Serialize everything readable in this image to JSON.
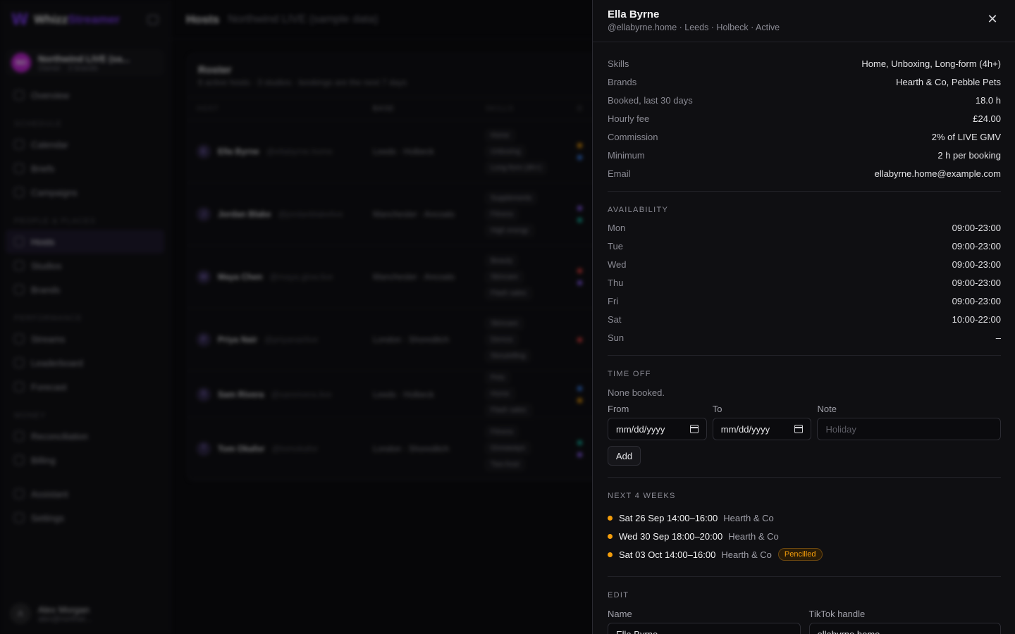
{
  "app": {
    "logo_name": "Whizz",
    "logo_accent": "Streamer",
    "page_title": "Hosts",
    "page_subtitle": "Northwind LIVE (sample data)"
  },
  "org": {
    "initials": "NO",
    "name": "Northwind LIVE (sa...",
    "sub": "Owner · 3 brands"
  },
  "sidebar": {
    "overview": "Overview",
    "sections": [
      "SCHEDULE",
      "PEOPLE & PLACES",
      "PERFORMANCE",
      "MONEY"
    ],
    "schedule": [
      "Calendar",
      "Briefs",
      "Campaigns"
    ],
    "people": [
      "Hosts",
      "Studios",
      "Brands"
    ],
    "performance": [
      "Streams",
      "Leaderboard",
      "Forecast"
    ],
    "money": [
      "Reconciliation",
      "Billing"
    ],
    "bottom": [
      "Assistant",
      "Settings"
    ]
  },
  "user": {
    "initial": "A",
    "name": "Alex Morgan",
    "email": "alex@northwi..."
  },
  "roster": {
    "title": "Roster",
    "subtitle": "6 active hosts · 3 studios · bookings are the next 7 days",
    "headers": [
      "HOST",
      "BASE",
      "SKILLS",
      "B"
    ],
    "rows": [
      {
        "initial": "E",
        "name": "Ella Byrne",
        "handle": "@ellabyrne.home",
        "base": "Leeds · Holbeck",
        "skills": [
          "Home",
          "Unboxing",
          "Long-form (4h+)"
        ]
      },
      {
        "initial": "J",
        "name": "Jordan Blake",
        "handle": "@jordanblakelive",
        "base": "Manchester · Ancoats",
        "skills": [
          "Supplements",
          "Fitness",
          "High energy"
        ]
      },
      {
        "initial": "M",
        "name": "Maya Chen",
        "handle": "@maya.glow.live",
        "base": "Manchester · Ancoats",
        "skills": [
          "Beauty",
          "Skincare",
          "Flash sales"
        ]
      },
      {
        "initial": "P",
        "name": "Priya Nair",
        "handle": "@priyanairlive",
        "base": "London · Shoreditch",
        "skills": [
          "Skincare",
          "Demos",
          "Storytelling"
        ]
      },
      {
        "initial": "S",
        "name": "Sam Rivera",
        "handle": "@samrivera.live",
        "base": "Leeds · Holbeck",
        "skills": [
          "Pets",
          "Home",
          "Flash sales"
        ]
      },
      {
        "initial": "T",
        "name": "Tom Okafor",
        "handle": "@tomokafor",
        "base": "London · Shoreditch",
        "skills": [
          "Fitness",
          "Giveaways",
          "Two-host"
        ]
      }
    ]
  },
  "drawer": {
    "name": "Ella Byrne",
    "subtitle": "@ellabyrne.home · Leeds · Holbeck · Active",
    "details": [
      {
        "k": "Skills",
        "v": "Home, Unboxing, Long-form (4h+)"
      },
      {
        "k": "Brands",
        "v": "Hearth & Co, Pebble Pets"
      },
      {
        "k": "Booked, last 30 days",
        "v": "18.0 h"
      },
      {
        "k": "Hourly fee",
        "v": "£24.00"
      },
      {
        "k": "Commission",
        "v": "2% of LIVE GMV"
      },
      {
        "k": "Minimum",
        "v": "2 h per booking"
      },
      {
        "k": "Email",
        "v": "ellabyrne.home@example.com"
      }
    ],
    "availability_title": "Availability",
    "availability": [
      {
        "k": "Mon",
        "v": "09:00-23:00"
      },
      {
        "k": "Tue",
        "v": "09:00-23:00"
      },
      {
        "k": "Wed",
        "v": "09:00-23:00"
      },
      {
        "k": "Thu",
        "v": "09:00-23:00"
      },
      {
        "k": "Fri",
        "v": "09:00-23:00"
      },
      {
        "k": "Sat",
        "v": "10:00-22:00"
      },
      {
        "k": "Sun",
        "v": "–"
      }
    ],
    "timeoff_title": "Time off",
    "timeoff_empty": "None booked.",
    "from_label": "From",
    "from_value": "mm/dd/yyyy",
    "to_label": "To",
    "to_value": "mm/dd/yyyy",
    "note_label": "Note",
    "note_placeholder": "Holiday",
    "add_label": "Add",
    "weeks_title": "Next 4 weeks",
    "bookings": [
      {
        "when": "Sat 26 Sep 14:00–16:00",
        "brand": "Hearth & Co",
        "badge": ""
      },
      {
        "when": "Wed 30 Sep 18:00–20:00",
        "brand": "Hearth & Co",
        "badge": ""
      },
      {
        "when": "Sat 03 Oct 14:00–16:00",
        "brand": "Hearth & Co",
        "badge": "Pencilled"
      }
    ],
    "edit_title": "Edit",
    "name_label": "Name",
    "name_value": "Ella Byrne",
    "tiktok_label": "TikTok handle",
    "tiktok_value": "ellabyrne.home"
  },
  "colors": {
    "accent": "#7c3aed",
    "booking_dot": "#f59e0b",
    "badge": "#f59e0b"
  }
}
